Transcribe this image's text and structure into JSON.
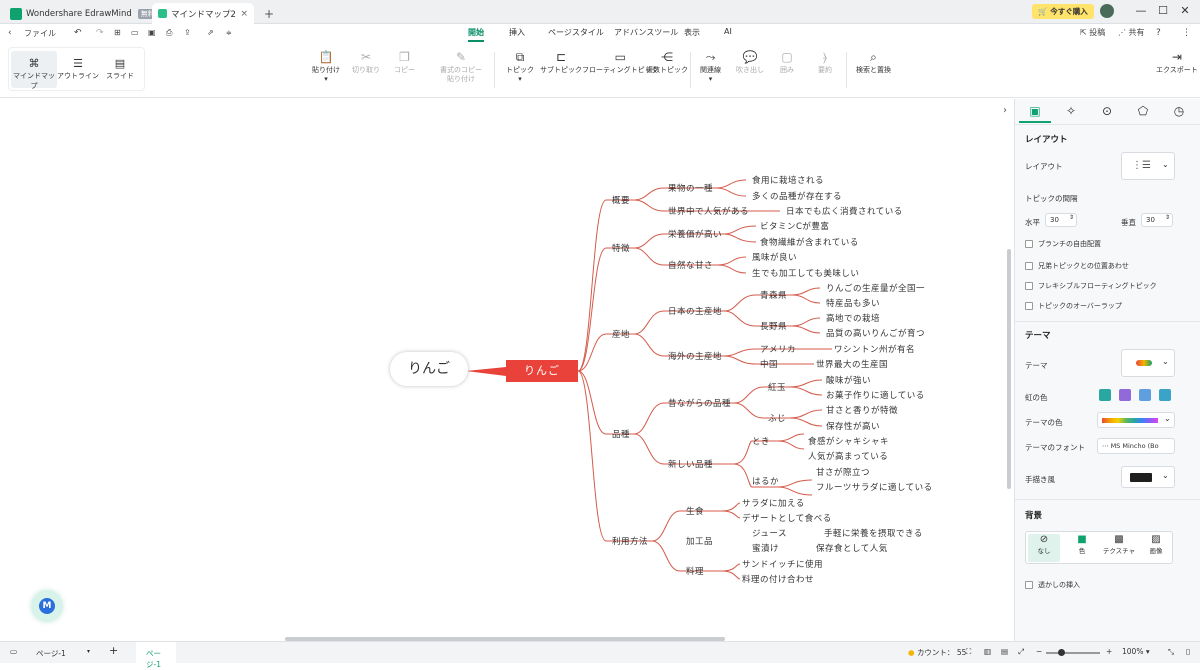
{
  "titlebar": {
    "app_title": "Wondershare EdrawMind",
    "app_badge": "無料",
    "doc_tab": "マインドマップ2",
    "new_tab": "+",
    "buy_label": "今すぐ購入",
    "colors": {
      "brand": "#0fa26e",
      "buy_bg": "#ffe36b"
    }
  },
  "quickbar": {
    "file_label": "ファイル",
    "menus": [
      "開始",
      "挿入",
      "ページスタイル",
      "アドバンスツール",
      "表示",
      "AI"
    ],
    "active_menu": "開始",
    "publish_label": "投稿",
    "share_label": "共有"
  },
  "ribbon": {
    "views": [
      "マインドマップ",
      "アウトライン",
      "スライド"
    ],
    "paste": "貼り付け",
    "cut": "切り取り",
    "copy": "コピー",
    "format_copy_1": "書式のコピー",
    "format_copy_2": "貼り付け",
    "topic": "トピック",
    "subtopic": "サブトピック",
    "floating": "フローティングトピック",
    "multi": "複数トピック",
    "relation": "関連線",
    "callout": "吹き出し",
    "boundary": "囲み",
    "summary": "要約",
    "find": "検索と置換",
    "export": "エクスポート"
  },
  "mindmap": {
    "root_outer": "りんご",
    "root": "りんご",
    "branches": [
      {
        "label": "概要"
      },
      {
        "label": "特徴"
      },
      {
        "label": "産地"
      },
      {
        "label": "品種"
      },
      {
        "label": "利用方法"
      }
    ],
    "l2": [
      "果物の一種",
      "世界中で人気がある",
      "栄養価が高い",
      "自然な甘さ",
      "日本の主産地",
      "海外の主産地",
      "昔ながらの品種",
      "新しい品種",
      "生食",
      "加工品",
      "料理"
    ],
    "l3": [
      "食用に栽培される",
      "多くの品種が存在する",
      "日本でも広く消費されている",
      "ビタミンCが豊富",
      "食物繊維が含まれている",
      "風味が良い",
      "生でも加工しても美味しい",
      "青森県",
      "長野県",
      "アメリカ",
      "中国",
      "紅玉",
      "ふじ",
      "とき",
      "はるか",
      "サラダに加える",
      "デザートとして食べる",
      "ジュース",
      "蜜漬け",
      "サンドイッチに使用",
      "料理の付け合わせ"
    ],
    "l4": [
      "りんごの生産量が全国一",
      "特産品も多い",
      "高地での栽培",
      "品質の高いりんごが育つ",
      "ワシントン州が有名",
      "世界最大の生産国",
      "酸味が強い",
      "お菓子作りに適している",
      "甘さと香りが特徴",
      "保存性が高い",
      "食感がシャキシャキ",
      "人気が高まっている",
      "甘さが際立つ",
      "フルーツサラダに適している",
      "手軽に栄養を摂取できる",
      "保存食として人気"
    ],
    "colors": {
      "root_fill": "#e8423a",
      "line": "#d45a4a"
    }
  },
  "panel": {
    "layout_heading": "レイアウト",
    "layout_label": "レイアウト",
    "spacing_label": "トピックの間隔",
    "horizontal_label": "水平",
    "horizontal_value": "30",
    "vertical_label": "垂直",
    "vertical_value": "30",
    "checks": [
      "ブランチの自由配置",
      "兄弟トピックとの位置あわせ",
      "フレキシブルフローティングトピック",
      "トピックのオーバーラップ"
    ],
    "theme_heading": "テーマ",
    "theme_label": "テーマ",
    "rainbow_label": "虹の色",
    "theme_color_label": "テーマの色",
    "theme_font_label": "テーマのフォント",
    "theme_font_value": "MS Mincho (Bo",
    "handdrawn_label": "手描き風",
    "bg_heading": "背景",
    "bg_options": [
      "なし",
      "色",
      "テクスチャ",
      "画像"
    ],
    "watermark_label": "透かしの挿入",
    "colors": {
      "accent": "#0fa26e"
    }
  },
  "status": {
    "page_select": "ページ-1",
    "page_tab": "ページ-1",
    "count_label": "カウント：",
    "count_value": "55",
    "zoom": "100%"
  }
}
